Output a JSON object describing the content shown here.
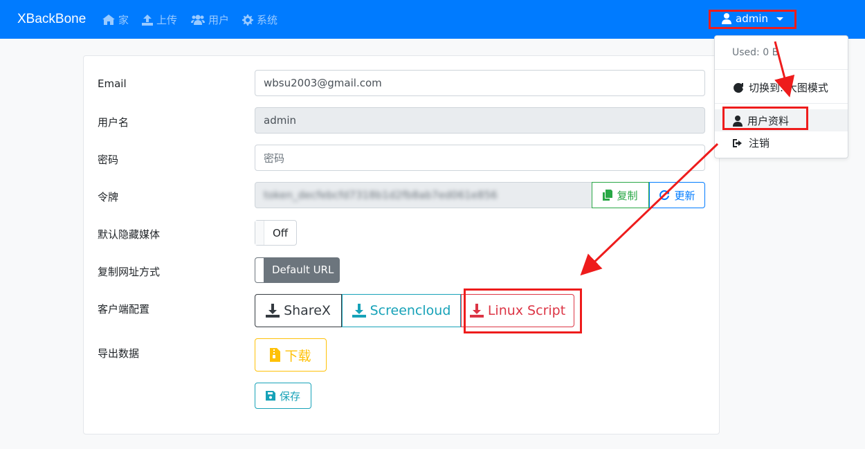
{
  "navbar": {
    "brand": "XBackBone",
    "items": [
      {
        "label": "家",
        "icon": "home-icon"
      },
      {
        "label": "上传",
        "icon": "upload-icon"
      },
      {
        "label": "用户",
        "icon": "users-icon"
      },
      {
        "label": "系统",
        "icon": "gear-icon"
      }
    ],
    "user": "admin"
  },
  "form": {
    "email": {
      "label": "Email",
      "value": "wbsu2003@gmail.com"
    },
    "username": {
      "label": "用户名",
      "value": "admin"
    },
    "password": {
      "label": "密码",
      "placeholder": "密码"
    },
    "token": {
      "label": "令牌",
      "value": "token_decfebcfd7318b1d2fb8ab7ed061e856",
      "copy_label": "复制",
      "refresh_label": "更新"
    },
    "hide_media": {
      "label": "默认隐藏媒体",
      "state": "Off"
    },
    "copy_url": {
      "label": "复制网址方式",
      "state": "Default URL"
    },
    "client_config": {
      "label": "客户端配置",
      "sharex": "ShareX",
      "screencloud": "Screencloud",
      "linux": "Linux Script"
    },
    "export": {
      "label": "导出数据",
      "button": "下载"
    },
    "save_label": "保存"
  },
  "dropdown": {
    "used": "Used: 0 B",
    "items": [
      {
        "label": "切换到: 大图模式",
        "icon": "refresh-icon"
      },
      {
        "label": "用户资料",
        "icon": "user-icon"
      },
      {
        "label": "注销",
        "icon": "logout-icon"
      }
    ]
  },
  "colors": {
    "primary": "#007bff",
    "success": "#28a745",
    "info": "#17a2b8",
    "danger": "#dc3545",
    "warning": "#ffc107",
    "annotation": "#ee1c1c"
  }
}
